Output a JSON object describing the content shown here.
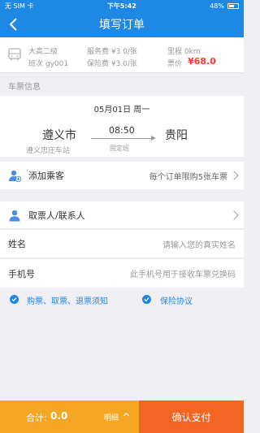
{
  "status_bar": {
    "carrier": "无 SIM 卡",
    "time": "下午5:42",
    "battery": "48%",
    "battery_level": 0.48
  },
  "nav": {
    "title": "填写订单",
    "back_icon": "chevron-left-icon"
  },
  "trip_info": {
    "bus_type": "大高二级",
    "schedule_no": "班次 gy001",
    "service_fee": "服务费 ¥3.0/张",
    "insurance_fee": "保险费 ¥3.0/张",
    "distance": "里程 0km",
    "fare_label": "票价",
    "fare": "¥68.0"
  },
  "ticket": {
    "section_label": "车票信息",
    "date": "05月01日 周一",
    "from_city": "遵义市",
    "from_station": "遵义忠庄车站",
    "departure_time": "08:50",
    "schedule_type": "固定班",
    "to_city": "贵阳"
  },
  "passenger": {
    "add_label": "添加乘客",
    "limit_hint": "每个订单限购5张车票"
  },
  "contact": {
    "label": "取票人/联系人",
    "name_label": "姓名",
    "name_placeholder": "请输入您的真实姓名",
    "phone_label": "手机号",
    "phone_placeholder": "此手机号用于接收车票兑换码"
  },
  "agreements": {
    "ticket_notice": "购票、取票、退票须知",
    "insurance": "保险协议"
  },
  "footer": {
    "total_label": "合计:",
    "total_value": "0.0",
    "detail_label": "明细",
    "pay_label": "确认支付"
  },
  "colors": {
    "primary": "#1e88e5",
    "price": "#ff3b30",
    "total_bg": "#f5a623",
    "pay_bg": "#f26522"
  }
}
